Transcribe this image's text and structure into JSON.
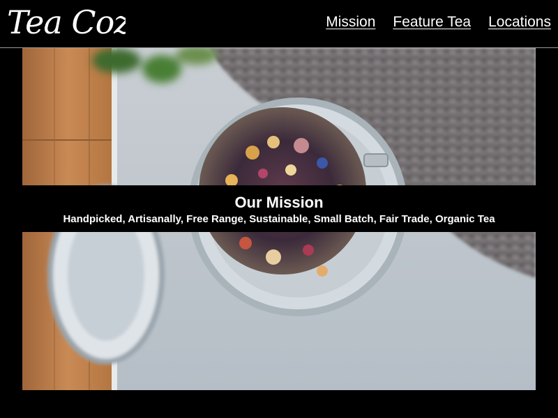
{
  "brand": {
    "logo_text": "Tea Cozy"
  },
  "nav": {
    "items": [
      {
        "label": "Mission"
      },
      {
        "label": "Feature Tea"
      },
      {
        "label": "Locations"
      }
    ]
  },
  "hero": {
    "title": "Our Mission",
    "subtitle": "Handpicked, Artisanally, Free Range, Sustainable, Small Batch, Fair Trade, Organic Tea"
  },
  "colors": {
    "page_background": "#000000",
    "text": "#ffffff",
    "header_border": "#9a9a9a"
  }
}
